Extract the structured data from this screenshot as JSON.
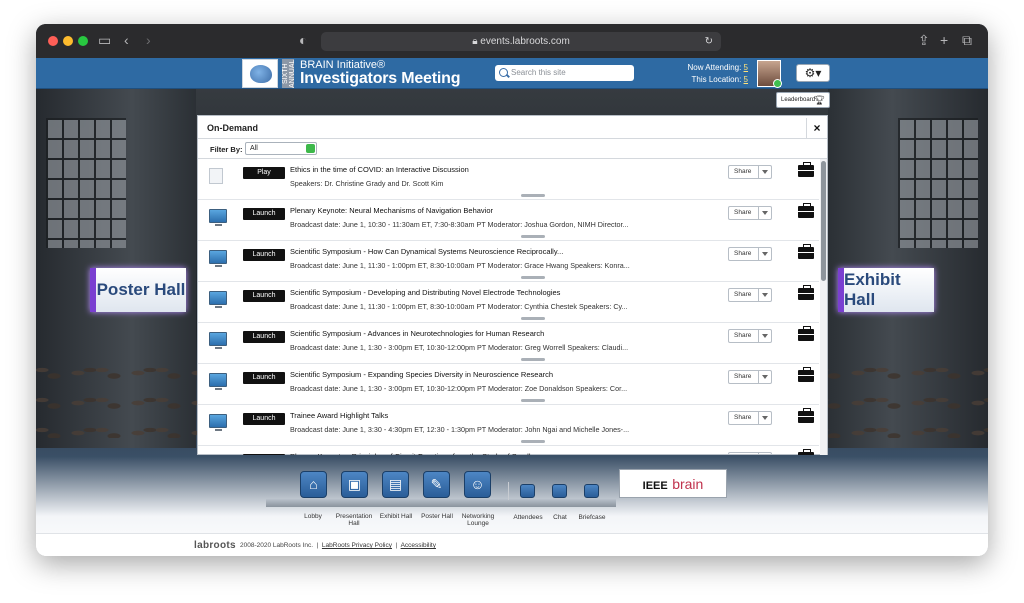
{
  "browser": {
    "url": "events.labroots.com"
  },
  "header": {
    "logo_side_text": "SIXTH ANNUAL",
    "title_small": "BRAIN Initiative®",
    "title_big": "Investigators Meeting",
    "search_placeholder": "Search this site",
    "now_attending_label": "Now Attending:",
    "now_attending_value": "5",
    "this_location_label": "This Location:",
    "this_location_value": "5",
    "leaderboard_label": "Leaderboard"
  },
  "halls": {
    "left_sign": "Poster Hall",
    "right_sign": "Exhibit Hall"
  },
  "modal": {
    "title": "On-Demand",
    "close": "×",
    "filter_label": "Filter By:",
    "filter_value": "All",
    "share_label": "Share",
    "rows": [
      {
        "icon": "document-icon",
        "button": "Play",
        "title": "Ethics in the time of COVID: an Interactive Discussion",
        "sub": "Speakers: Dr. Christine Grady and Dr. Scott Kim"
      },
      {
        "icon": "monitor-icon",
        "button": "Launch",
        "title": "Plenary Keynote: Neural Mechanisms of Navigation Behavior",
        "sub": "Broadcast date: June 1, 10:30 - 11:30am ET, 7:30-8:30am PT Moderator: Joshua Gordon, NIMH Director..."
      },
      {
        "icon": "monitor-icon",
        "button": "Launch",
        "title": "Scientific Symposium - How Can Dynamical Systems Neuroscience Reciprocally...",
        "sub": "Broadcast date: June 1, 11:30 - 1:00pm ET, 8:30-10:00am PT Moderator: Grace Hwang Speakers: Konra..."
      },
      {
        "icon": "monitor-icon",
        "button": "Launch",
        "title": "Scientific Symposium - Developing and Distributing Novel Electrode Technologies",
        "sub": "Broadcast date: June 1, 11:30 - 1:00pm ET, 8:30-10:00am PT Moderator: Cynthia Chestek Speakers: Cy..."
      },
      {
        "icon": "monitor-icon",
        "button": "Launch",
        "title": "Scientific Symposium - Advances in Neurotechnologies for Human Research",
        "sub": "Broadcast date: June 1, 1:30 - 3:00pm ET, 10:30-12:00pm PT Moderator: Greg Worrell Speakers: Claudi..."
      },
      {
        "icon": "monitor-icon",
        "button": "Launch",
        "title": "Scientific Symposium - Expanding Species Diversity in Neuroscience Research",
        "sub": "Broadcast date: June 1, 1:30 - 3:00pm ET, 10:30-12:00pm PT Moderator: Zoe Donaldson Speakers: Cor..."
      },
      {
        "icon": "monitor-icon",
        "button": "Launch",
        "title": "Trainee Award Highlight Talks",
        "sub": "Broadcast date: June 1, 3:30 - 4:30pm ET, 12:30 - 1:30pm PT Moderator: John Ngai and Michelle Jones-..."
      },
      {
        "icon": "monitor-icon",
        "button": "Launch",
        "title": "Plenary Keynote - Principles of Circuit Functions from the Study of Small",
        "sub": ""
      }
    ]
  },
  "nav": {
    "lobby": "Lobby",
    "presentation_hall_1": "Presentation",
    "presentation_hall_2": "Hall",
    "exhibit_hall": "Exhibit Hall",
    "poster_hall": "Poster Hall",
    "networking_1": "Networking",
    "networking_2": "Lounge",
    "attendees": "Attendees",
    "chat": "Chat",
    "briefcase": "Briefcase",
    "sponsor_a": "IEEE",
    "sponsor_b": "brain"
  },
  "footer": {
    "logo": "labroots",
    "copyright": "2008-2020 LabRoots Inc.",
    "privacy": "LabRoots Privacy Policy",
    "accessibility": "Accessibility"
  }
}
